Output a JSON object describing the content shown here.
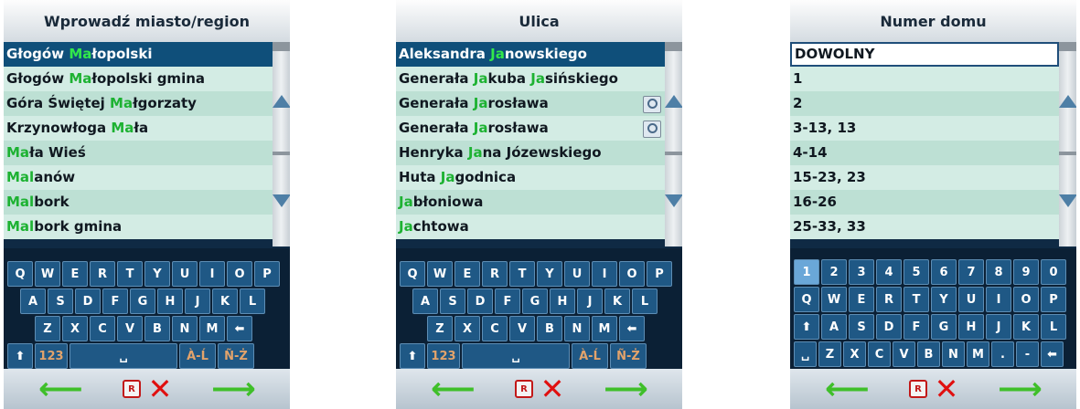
{
  "panels": [
    {
      "title": "Wprowadź miasto/region",
      "rows": [
        {
          "p": "Głogów ",
          "h": "Ma",
          "s": "łopolski"
        },
        {
          "p": "Głogów ",
          "h": "Ma",
          "s": "łopolski gmina"
        },
        {
          "p": "Góra Świętej ",
          "h": "Ma",
          "s": "łgorzaty"
        },
        {
          "p": "Krzynowłoga ",
          "h": "Ma",
          "s": "ła"
        },
        {
          "p": "",
          "h": "Ma",
          "s": "ła Wieś"
        },
        {
          "p": "",
          "h": "Mal",
          "s": "anów"
        },
        {
          "p": "",
          "h": "Mal",
          "s": "bork"
        },
        {
          "p": "",
          "h": "Mal",
          "s": "bork gmina"
        }
      ],
      "keyboard": {
        "row1": [
          "Q",
          "W",
          "E",
          "R",
          "T",
          "Y",
          "U",
          "I",
          "O",
          "P"
        ],
        "row2": [
          "A",
          "S",
          "D",
          "F",
          "G",
          "H",
          "J",
          "K",
          "L"
        ],
        "row3": [
          "Z",
          "X",
          "C",
          "V",
          "B",
          "N",
          "M",
          "⬅"
        ],
        "row4": [
          "⬆",
          "123",
          "␣",
          "À-Ĺ",
          "Ñ-Ż"
        ]
      }
    },
    {
      "title": "Ulica",
      "rows": [
        {
          "p": "Aleksandra ",
          "h": "Ja",
          "s": "nowskiego"
        },
        {
          "p": "Generała ",
          "h": "Ja",
          "s": "kuba ",
          "h2": "Ja",
          "s2": "sińskiego"
        },
        {
          "p": "Generała ",
          "h": "Ja",
          "s": "rosława",
          "mag": true
        },
        {
          "p": "Generała ",
          "h": "Ja",
          "s": "rosława",
          "mag": true
        },
        {
          "p": "Henryka ",
          "h": "Ja",
          "s": "na Józewskiego"
        },
        {
          "p": "Huta ",
          "h": "Ja",
          "s": "godnica"
        },
        {
          "p": "",
          "h": "Ja",
          "s": "błoniowa"
        },
        {
          "p": "",
          "h": "Ja",
          "s": "chtowa"
        }
      ],
      "keyboard": {
        "row1": [
          "Q",
          "W",
          "E",
          "R",
          "T",
          "Y",
          "U",
          "I",
          "O",
          "P"
        ],
        "row2": [
          "A",
          "S",
          "D",
          "F",
          "G",
          "H",
          "J",
          "K",
          "L"
        ],
        "row3": [
          "Z",
          "X",
          "C",
          "V",
          "B",
          "N",
          "M",
          "⬅"
        ],
        "row4": [
          "⬆",
          "123",
          "␣",
          "À-Ĺ",
          "Ñ-Ż"
        ]
      }
    },
    {
      "title": "Numer domu",
      "rows": [
        {
          "p": "DOWOLNY"
        },
        {
          "p": "1"
        },
        {
          "p": "2"
        },
        {
          "p": "3-13, 13"
        },
        {
          "p": "4-14"
        },
        {
          "p": "15-23, 23"
        },
        {
          "p": "16-26"
        },
        {
          "p": "25-33, 33"
        }
      ],
      "keyboard": {
        "row0": [
          "1",
          "2",
          "3",
          "4",
          "5",
          "6",
          "7",
          "8",
          "9",
          "0"
        ],
        "row1": [
          "Q",
          "W",
          "E",
          "R",
          "T",
          "Y",
          "U",
          "I",
          "O",
          "P"
        ],
        "row2": [
          "⬆",
          "A",
          "S",
          "D",
          "F",
          "G",
          "H",
          "J",
          "K",
          "L"
        ],
        "row3": [
          "␣",
          "Z",
          "X",
          "C",
          "V",
          "B",
          "N",
          "M",
          ".",
          "-",
          "⬅"
        ]
      }
    }
  ],
  "footer": {
    "back": "⟵",
    "confirm": "⟶",
    "cancel": "✕",
    "addr": "R"
  },
  "colors": {
    "selected_row": "#0f4f7a",
    "match_highlight": "#1db232",
    "key_bg": "#1f5885"
  },
  "icons": [
    "scroll-up-icon",
    "scroll-down-icon",
    "magnifier-icon",
    "back-arrow-icon",
    "forward-arrow-icon",
    "cancel-icon",
    "address-icon"
  ]
}
